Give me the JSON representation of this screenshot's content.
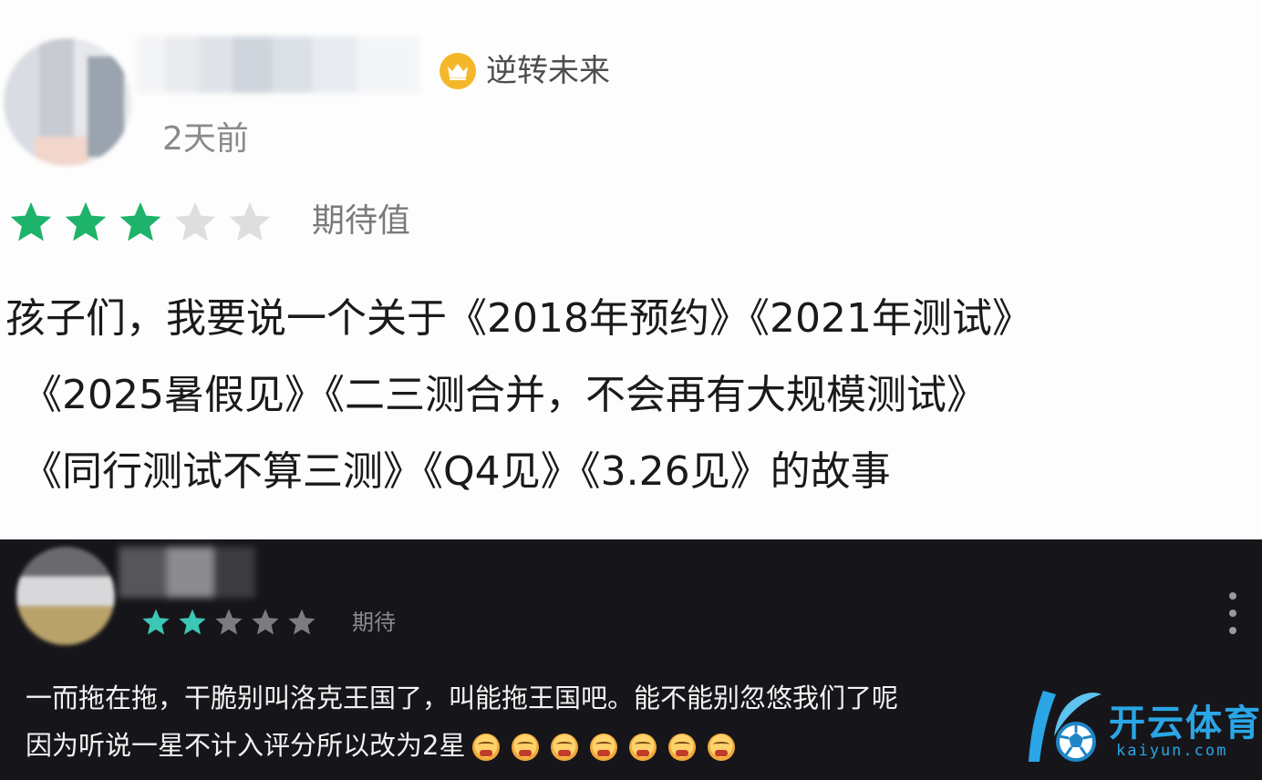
{
  "review_light": {
    "badge_title": "逆转未来",
    "time": "2天前",
    "rating": {
      "filled": 3,
      "total": 5,
      "filled_color": "#1db36a",
      "empty_color": "#dedede"
    },
    "rating_label": "期待值",
    "text_lines": [
      "孩子们，我要说一个关于《2018年预约》《2021年测试》",
      "《2025暑假见》《二三测合并，不会再有大规模测试》",
      "《同行测试不算三测》《Q4见》《3.26见》的故事"
    ],
    "badge_icon": "crown-icon",
    "badge_color": "#f5b72a"
  },
  "review_dark": {
    "rating": {
      "filled": 2,
      "total": 5,
      "filled_color": "#3cc6b4",
      "empty_color": "#7c7c80"
    },
    "rating_label": "期待",
    "text_lines": [
      "一而拖在拖，干脆别叫洛克王国了，叫能拖王国吧。能不能别忽悠我们了呢",
      "因为听说一星不计入评分所以改为2星"
    ],
    "emoji_count": 7,
    "emoji_icon": "scream-emoji-icon",
    "more_icon": "more-vertical-icon"
  },
  "watermark": {
    "brand": "开云体育",
    "domain": "kaiyun.com",
    "logo_icon": "soccer-ball-logo-icon",
    "color": "#2aa6e6"
  }
}
